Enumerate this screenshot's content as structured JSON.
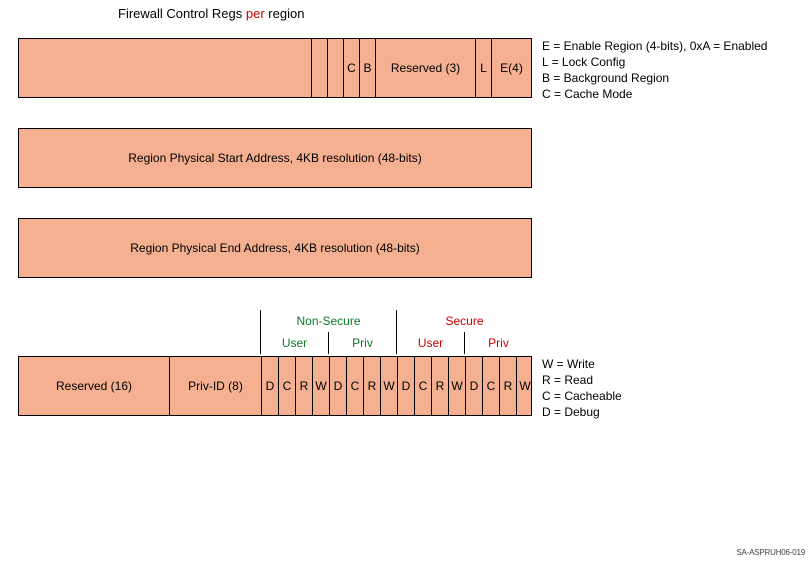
{
  "title_pre": "Firewall Control Regs ",
  "title_per": "per",
  "title_post": " region",
  "row1": {
    "spacer": "",
    "c": "C",
    "b": "B",
    "reserved": "Reserved (3)",
    "l": "L",
    "e": "E(4)"
  },
  "legend1": {
    "e": "E = Enable Region (4-bits), 0xA = Enabled",
    "l": "L = Lock Config",
    "b": "B = Background Region",
    "c": "C = Cache Mode"
  },
  "row2": "Region Physical Start Address, 4KB resolution (48-bits)",
  "row3": "Region Physical End Address, 4KB resolution (48-bits)",
  "hdr_top": {
    "nonsec": "Non-Secure",
    "sec": "Secure"
  },
  "hdr_sub": {
    "user": "User",
    "priv": "Priv"
  },
  "row4": {
    "res16": "Reserved (16)",
    "privid": "Priv-ID (8)",
    "d": "D",
    "c": "C",
    "r": "R",
    "w": "W"
  },
  "legend4": {
    "w": "W = Write",
    "r": "R = Read",
    "c": "C = Cacheable",
    "d": "D = Debug"
  },
  "stub": "SA-ASPRUH06-019"
}
